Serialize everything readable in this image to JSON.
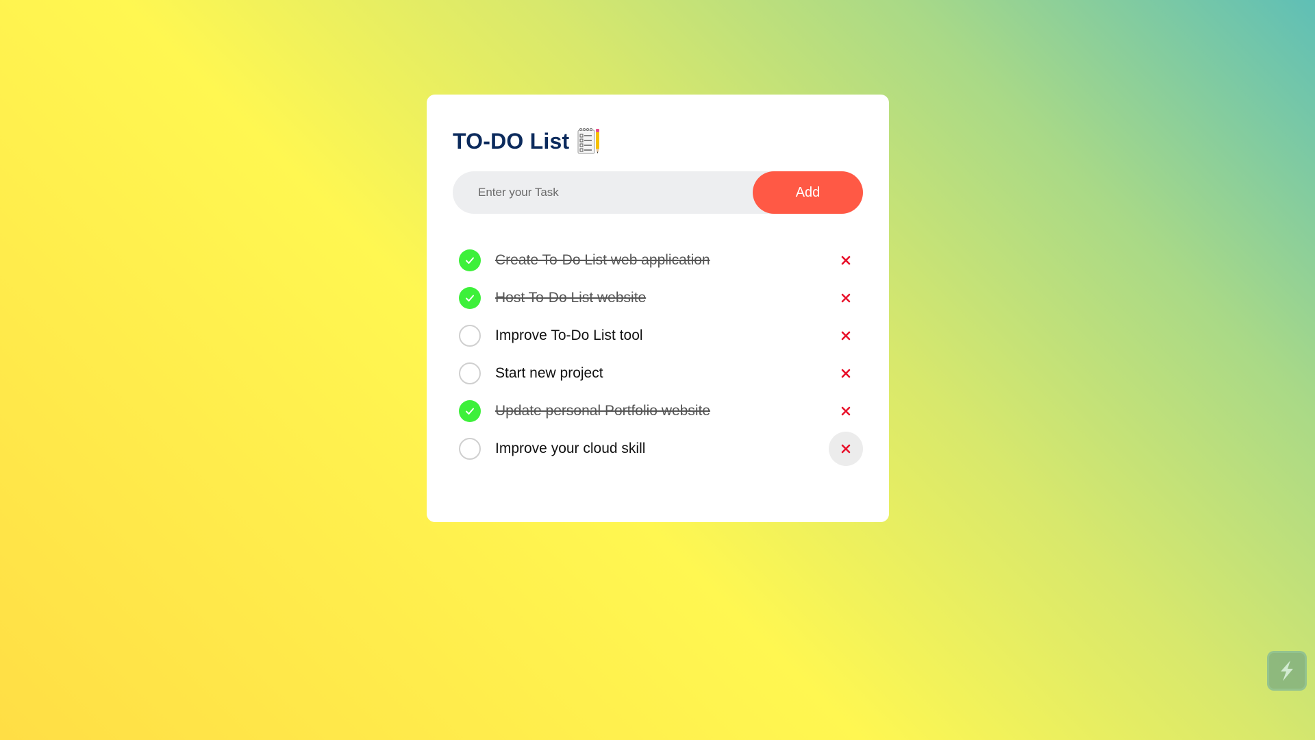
{
  "app": {
    "title": "TO-DO List",
    "title_icon": "notepad-pencil-icon"
  },
  "input": {
    "placeholder": "Enter your Task",
    "value": "",
    "add_label": "Add"
  },
  "tasks": [
    {
      "text": "Create To-Do List web application",
      "done": true
    },
    {
      "text": "Host To-Do List website",
      "done": true
    },
    {
      "text": "Improve To-Do List tool",
      "done": false
    },
    {
      "text": "Start new project",
      "done": false
    },
    {
      "text": "Update personal Portfolio website",
      "done": true
    },
    {
      "text": "Improve your cloud skill",
      "done": false
    }
  ],
  "colors": {
    "accent": "#ff5945",
    "check_done": "#3df03a",
    "delete_icon": "#e8102a",
    "title": "#0b2a5c"
  },
  "icons": {
    "check": "checkmark-icon",
    "delete": "close-icon",
    "corner_widget": "lightning-widget-icon"
  }
}
